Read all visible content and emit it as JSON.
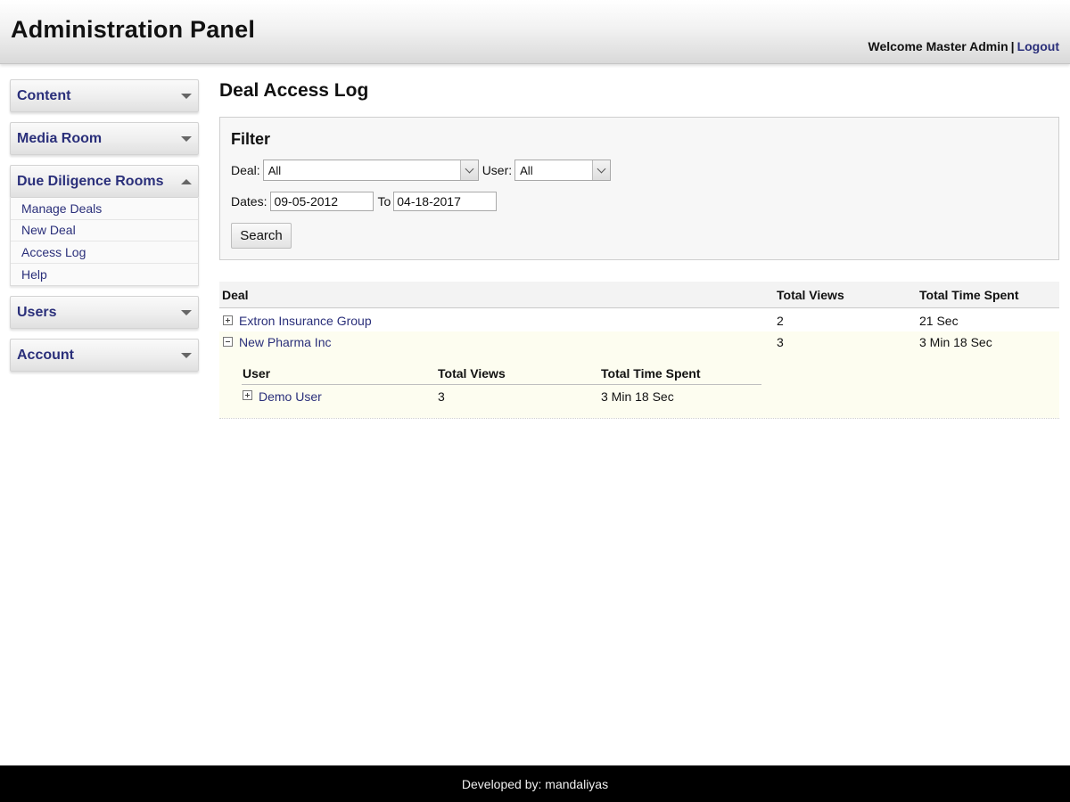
{
  "header": {
    "title": "Administration Panel",
    "welcome": "Welcome Master Admin",
    "separator": "|",
    "logout": "Logout"
  },
  "sidebar": {
    "sections": [
      {
        "label": "Content",
        "expanded": false
      },
      {
        "label": "Media Room",
        "expanded": false
      },
      {
        "label": "Due Diligence Rooms",
        "expanded": true,
        "items": [
          "Manage Deals",
          "New Deal",
          "Access Log",
          "Help"
        ]
      },
      {
        "label": "Users",
        "expanded": false
      },
      {
        "label": "Account",
        "expanded": false
      }
    ]
  },
  "main": {
    "page_title": "Deal Access Log",
    "filter": {
      "title": "Filter",
      "deal_label": "Deal:",
      "deal_value": "All",
      "user_label": "User:",
      "user_value": "All",
      "dates_label": "Dates:",
      "date_from": "09-05-2012",
      "to_label": "To",
      "date_to": "04-18-2017",
      "search_label": "Search"
    },
    "table": {
      "headers": [
        "Deal",
        "Total Views",
        "Total Time Spent"
      ],
      "rows": [
        {
          "deal": "Extron Insurance Group",
          "views": "2",
          "time": "21 Sec"
        },
        {
          "deal": "New Pharma Inc",
          "views": "3",
          "time": "3 Min 18 Sec"
        }
      ],
      "sub_headers": [
        "User",
        "Total Views",
        "Total Time Spent"
      ],
      "sub_rows": [
        {
          "user": "Demo User",
          "views": "3",
          "time": "3 Min 18 Sec"
        }
      ]
    }
  },
  "footer": {
    "text": "Developed by: mandaliyas"
  }
}
